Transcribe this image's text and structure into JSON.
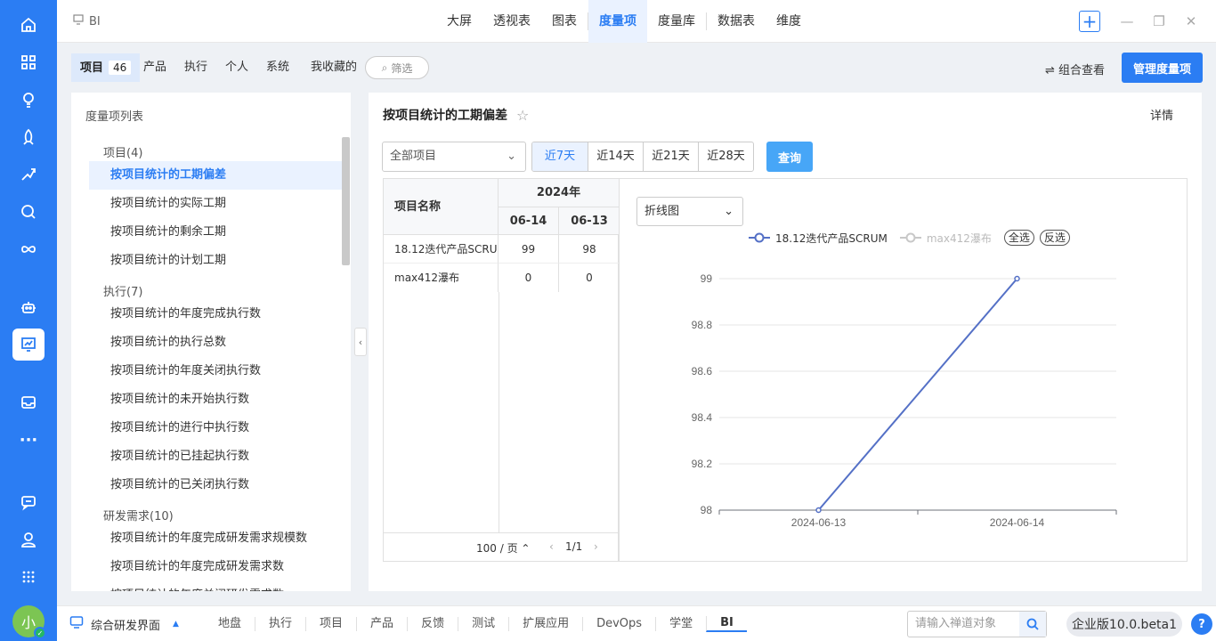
{
  "app": {
    "title": "BI"
  },
  "topnav": {
    "tabs": [
      "大屏",
      "透视表",
      "图表",
      "度量项",
      "度量库",
      "数据表",
      "维度"
    ],
    "active": "度量项"
  },
  "filterbar": {
    "tabs": [
      {
        "label": "项目",
        "count": "46"
      },
      {
        "label": "产品"
      },
      {
        "label": "执行"
      },
      {
        "label": "个人"
      },
      {
        "label": "系统"
      },
      {
        "label": "我收藏的"
      }
    ],
    "search_label": "筛选",
    "combo_label": "组合查看",
    "manage_label": "管理度量项"
  },
  "sidebar": {
    "title": "度量项列表",
    "groups": [
      {
        "label": "项目(4)",
        "items": [
          "按项目统计的工期偏差",
          "按项目统计的实际工期",
          "按项目统计的剩余工期",
          "按项目统计的计划工期"
        ]
      },
      {
        "label": "执行(7)",
        "items": [
          "按项目统计的年度完成执行数",
          "按项目统计的执行总数",
          "按项目统计的年度关闭执行数",
          "按项目统计的未开始执行数",
          "按项目统计的进行中执行数",
          "按项目统计的已挂起执行数",
          "按项目统计的已关闭执行数"
        ]
      },
      {
        "label": "研发需求(10)",
        "items": [
          "按项目统计的年度完成研发需求规模数",
          "按项目统计的年度完成研发需求数",
          "按项目统计的年度关闭研发需求数"
        ]
      }
    ],
    "active_item": "按项目统计的工期偏差"
  },
  "detail": {
    "title": "按项目统计的工期偏差",
    "detail_link": "详情",
    "project_select": "全部项目",
    "ranges": [
      "近7天",
      "近14天",
      "近21天",
      "近28天"
    ],
    "active_range": "近7天",
    "query_label": "查询"
  },
  "table": {
    "name_header": "项目名称",
    "year_header": "2024年",
    "date_headers": [
      "06-14",
      "06-13"
    ],
    "rows": [
      {
        "name": "18.12迭代产品SCRUM",
        "values": [
          "99",
          "98"
        ]
      },
      {
        "name": "max412瀑布",
        "values": [
          "0",
          "0"
        ]
      }
    ],
    "page_size": "100 / 页",
    "page": "1/1"
  },
  "chart_type_label": "折线图",
  "legend_buttons": {
    "select_all": "全选",
    "invert": "反选"
  },
  "colors": {
    "primary": "#2b7df3",
    "series1": "#5470c6",
    "series2_inactive": "#c8c8c8",
    "sidebar_bg": "#2b7df3"
  },
  "chart_data": {
    "type": "line",
    "x": [
      "2024-06-13",
      "2024-06-14"
    ],
    "series": [
      {
        "name": "18.12迭代产品SCRUM",
        "values": [
          98,
          99
        ],
        "active": true
      },
      {
        "name": "max412瀑布",
        "values": [
          0,
          0
        ],
        "active": false
      }
    ],
    "ylim": [
      98,
      99
    ],
    "yticks": [
      "98",
      "98.2",
      "98.4",
      "98.6",
      "98.8",
      "99"
    ],
    "grid": true,
    "legend_position": "top"
  },
  "bottombar": {
    "workspace": "综合研发界面",
    "tabs": [
      "地盘",
      "执行",
      "项目",
      "产品",
      "反馈",
      "测试",
      "扩展应用",
      "DevOps",
      "学堂",
      "BI"
    ],
    "active_tab": "BI",
    "search_placeholder": "请输入禅道对象",
    "edition": "企业版10.0.beta1"
  },
  "user": {
    "avatar_char": "小"
  }
}
